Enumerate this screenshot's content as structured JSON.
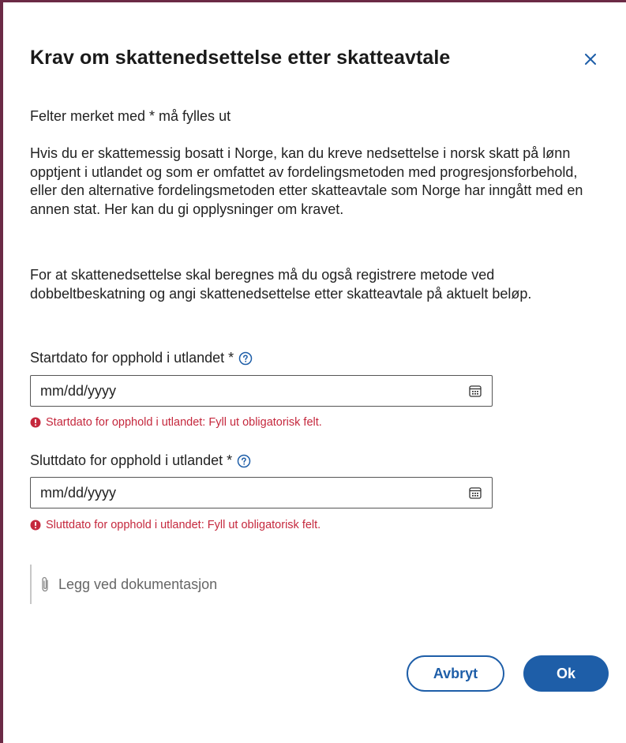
{
  "dialog": {
    "title": "Krav om skattenedsettelse etter skatteavtale",
    "close_icon": "close-icon",
    "required_note": "Felter merket med * må fylles ut",
    "intro_text": "Hvis du er skattemessig bosatt i Norge, kan du kreve nedsettelse i norsk skatt på lønn opptjent i utlandet og som er omfattet av fordelingsmetoden med progresjonsforbehold, eller den alternative fordelingsmetoden etter skatteavtale som Norge har inngått med en annen stat. Her kan du gi opplysninger om kravet.",
    "method_text": "For at skattenedsettelse skal beregnes må du også registrere metode ved dobbeltbeskatning og angi skattenedsettelse etter skatteavtale på aktuelt beløp."
  },
  "fields": {
    "start": {
      "label": "Startdato for opphold i utlandet *",
      "placeholder": "mm/dd/yyyy",
      "value": "",
      "error": "Startdato for opphold i utlandet: Fyll ut obligatorisk felt.",
      "help_icon": "help-circle-icon",
      "calendar_icon": "calendar-icon"
    },
    "end": {
      "label": "Sluttdato for opphold i utlandet *",
      "placeholder": "mm/dd/yyyy",
      "value": "",
      "error": "Sluttdato for opphold i utlandet: Fyll ut obligatorisk felt.",
      "help_icon": "help-circle-icon",
      "calendar_icon": "calendar-icon"
    }
  },
  "attachment": {
    "label": "Legg ved dokumentasjon",
    "icon": "paperclip-icon"
  },
  "actions": {
    "cancel_label": "Avbryt",
    "ok_label": "Ok"
  },
  "colors": {
    "frame": "#6b2a45",
    "primary": "#1e5ea8",
    "error": "#c5283d"
  }
}
